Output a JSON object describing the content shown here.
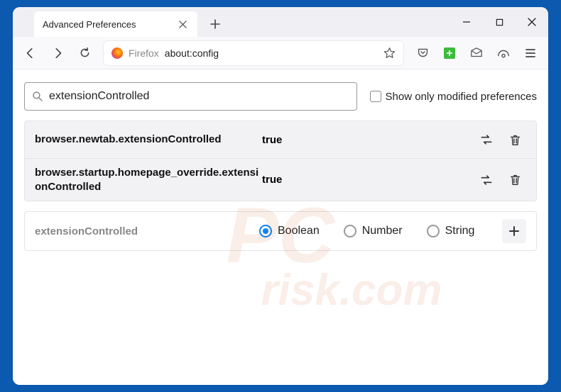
{
  "tab": {
    "title": "Advanced Preferences"
  },
  "urlbar": {
    "label": "Firefox",
    "url": "about:config"
  },
  "search": {
    "value": "extensionControlled",
    "checkbox_label": "Show only modified preferences"
  },
  "prefs": [
    {
      "name": "browser.newtab.extensionControlled",
      "value": "true"
    },
    {
      "name": "browser.startup.homepage_override.extensionControlled",
      "value": "true"
    }
  ],
  "newpref": {
    "name": "extensionControlled",
    "types": [
      "Boolean",
      "Number",
      "String"
    ],
    "selected": "Boolean"
  },
  "watermark": {
    "top": "PC",
    "bottom": "risk.com"
  }
}
